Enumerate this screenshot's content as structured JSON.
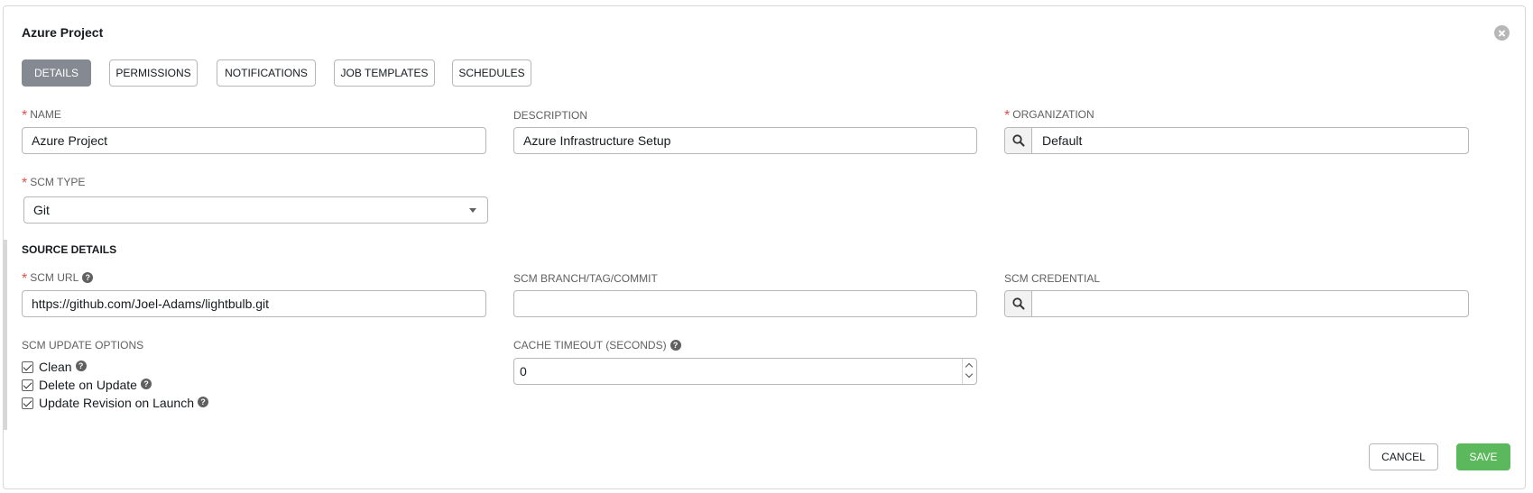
{
  "form": {
    "title": "Azure Project"
  },
  "tabs": [
    {
      "label": "DETAILS",
      "active": true
    },
    {
      "label": "PERMISSIONS",
      "active": false
    },
    {
      "label": "NOTIFICATIONS",
      "active": false
    },
    {
      "label": "JOB TEMPLATES",
      "active": false
    },
    {
      "label": "SCHEDULES",
      "active": false
    }
  ],
  "fields": {
    "name": {
      "label": "NAME",
      "value": "Azure Project",
      "required": true
    },
    "description": {
      "label": "DESCRIPTION",
      "value": "Azure Infrastructure Setup"
    },
    "organization": {
      "label": "ORGANIZATION",
      "value": "Default",
      "required": true
    },
    "scm_type": {
      "label": "SCM TYPE",
      "value": "Git",
      "required": true
    },
    "scm_url": {
      "label": "SCM URL",
      "value": "https://github.com/Joel-Adams/lightbulb.git",
      "required": true
    },
    "scm_branch": {
      "label": "SCM BRANCH/TAG/COMMIT",
      "value": ""
    },
    "scm_credential": {
      "label": "SCM CREDENTIAL",
      "value": ""
    },
    "cache_timeout": {
      "label": "CACHE TIMEOUT (SECONDS)",
      "value": "0"
    }
  },
  "source_details": {
    "title": "SOURCE DETAILS"
  },
  "update_options": {
    "label": "SCM UPDATE OPTIONS",
    "items": [
      {
        "label": "Clean",
        "checked": true
      },
      {
        "label": "Delete on Update",
        "checked": true
      },
      {
        "label": "Update Revision on Launch",
        "checked": true
      }
    ]
  },
  "actions": {
    "cancel_label": "CANCEL",
    "save_label": "SAVE"
  },
  "colors": {
    "active_tab": "#848992",
    "save": "#5cb85c",
    "required": "#d9534f"
  },
  "icons": {
    "close": "close-icon",
    "lookup": "search-icon",
    "help": "help-icon",
    "caret": "chevron-down-icon"
  }
}
